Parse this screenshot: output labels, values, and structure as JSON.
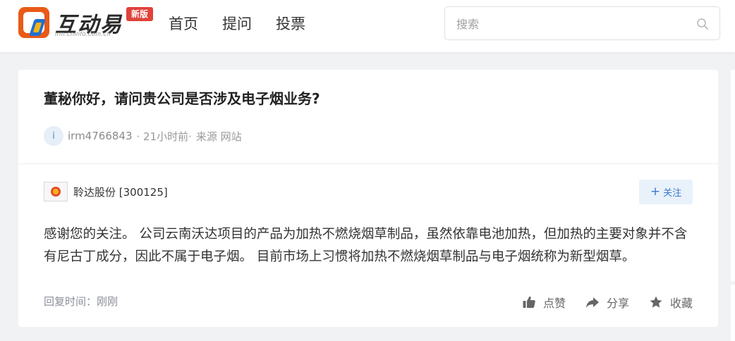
{
  "header": {
    "logo": {
      "title": "互动易",
      "subtitle": "irm.cninfo.com.cn",
      "badge": "新版",
      "colors": {
        "mark": "#e95a17",
        "blue": "#1f6fd1",
        "gold": "#f6b417",
        "badge": "#e0423a"
      }
    },
    "nav": [
      {
        "label": "首页"
      },
      {
        "label": "提问"
      },
      {
        "label": "投票"
      }
    ],
    "search": {
      "placeholder": "搜索",
      "value": "",
      "icon": "search-icon"
    }
  },
  "question": {
    "title": "董秘你好，请问贵公司是否涉及电子烟业务?",
    "avatar_letter": "i",
    "user": "irm4766843",
    "time": "· 21小时前·",
    "source": "来源 网站"
  },
  "answer": {
    "company": "聆达股份 [300125]",
    "follow_label": "关注",
    "follow_icon": "plus-icon",
    "text": "感谢您的关注。 公司云南沃达项目的产品为加热不燃烧烟草制品，虽然依靠电池加热，但加热的主要对象并不含有尼古丁成分，因此不属于电子烟。 目前市场上习惯将加热不燃烧烟草制品与电子烟统称为新型烟草。",
    "reply_time": "回复时间：刚刚",
    "actions": [
      {
        "label": "点赞",
        "icon": "thumbs-up-icon"
      },
      {
        "label": "分享",
        "icon": "share-icon"
      },
      {
        "label": "收藏",
        "icon": "star-icon"
      }
    ]
  },
  "colors": {
    "page_bg": "#f1f2f4",
    "accent": "#3a78c8",
    "follow_bg": "#e9f1fb"
  }
}
